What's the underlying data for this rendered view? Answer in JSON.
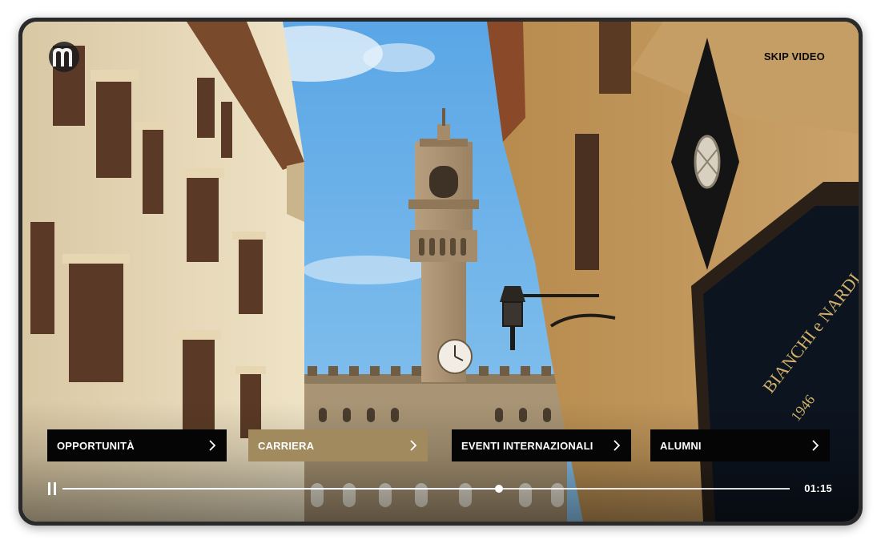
{
  "header": {
    "logo_icon": "m-logo-icon",
    "skip_label": "SKIP VIDEO"
  },
  "nav": {
    "items": [
      {
        "label": "OPPORTUNITÀ",
        "icon": "chevron-right-icon",
        "active": false
      },
      {
        "label": "CARRIERA",
        "icon": "chevron-right-icon",
        "active": true
      },
      {
        "label": "EVENTI INTERNAZIONALI",
        "icon": "chevron-right-icon",
        "active": false
      },
      {
        "label": "ALUMNI",
        "icon": "chevron-right-icon",
        "active": false
      }
    ]
  },
  "player": {
    "pause_icon": "pause-icon",
    "progress": 0.6,
    "time": "01:15"
  },
  "scene": {
    "shop_sign_line1": "BIANCHI e NARDI",
    "shop_sign_line2": "1946"
  },
  "colors": {
    "active_nav": "#a08a5e",
    "nav_bg": "#050505",
    "text_light": "#ffffff",
    "skip_text": "#0b0b0b"
  }
}
